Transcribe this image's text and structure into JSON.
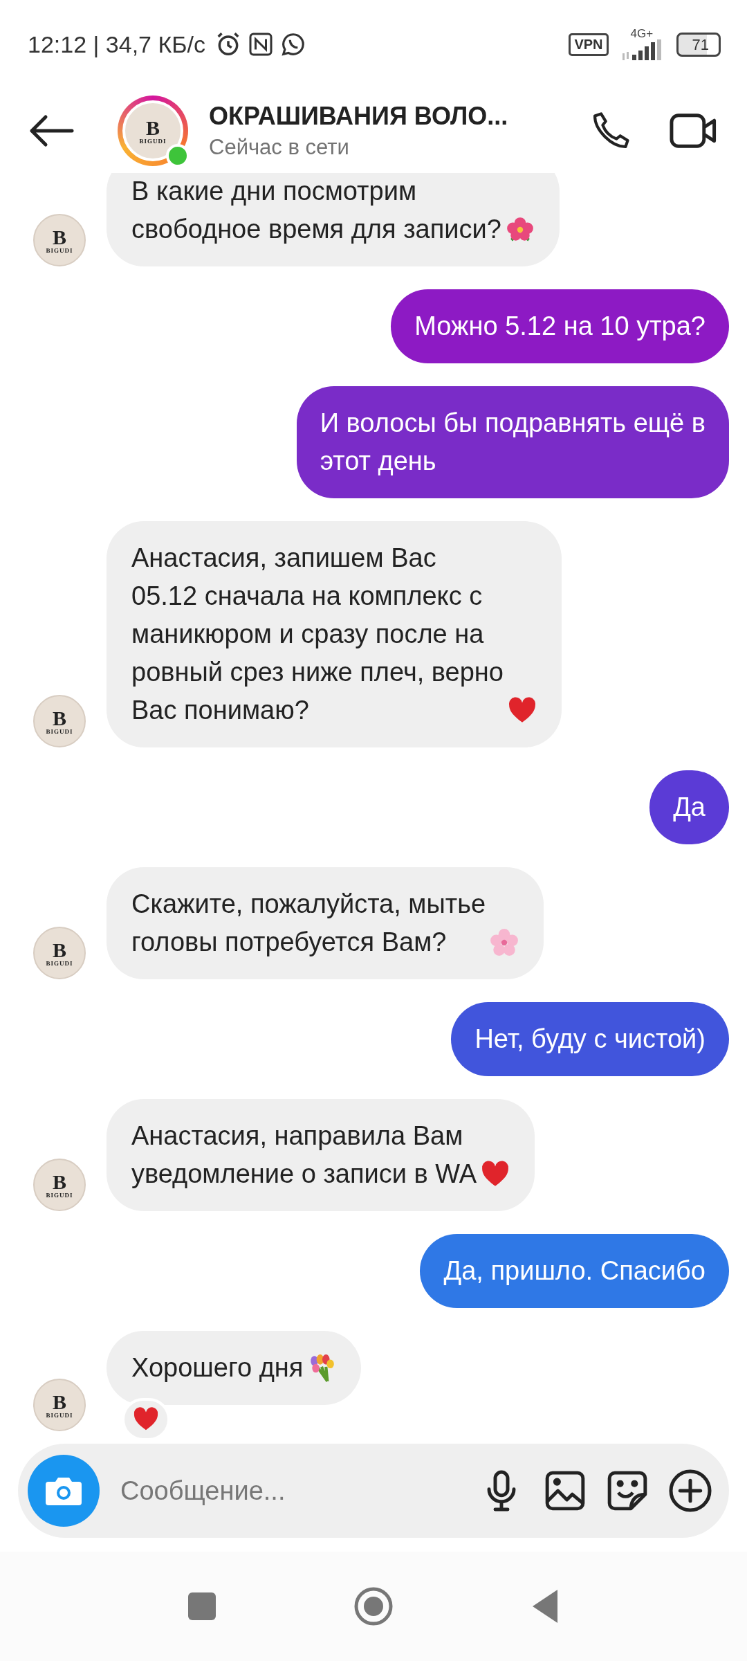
{
  "status_bar": {
    "time": "12:12 | 34,7 КБ/с",
    "vpn": "VPN",
    "network": "4G+",
    "battery": "71"
  },
  "header": {
    "title": "ОКРАШИВАНИЯ ВОЛО...",
    "subtitle": "Сейчас в сети",
    "online": true,
    "avatar": {
      "letter": "B",
      "caption": "BIGUDI"
    }
  },
  "messages": [
    {
      "kind": "incoming",
      "text": "В какие дни посмотрим\nсвободное время для записи?",
      "emoji": {
        "kind": "hibiscus"
      },
      "avatar": {
        "letter": "B",
        "caption": "BIGUDI"
      }
    },
    {
      "kind": "outgoing",
      "text": "Можно 5.12 на 10 утра?",
      "color": "#8d1ac4"
    },
    {
      "kind": "outgoing",
      "text": "И волосы бы подравнять ещё в\nэтот день",
      "color": "#7a2cc8"
    },
    {
      "kind": "incoming",
      "text": "Анастасия, запишем Вас\n05.12 сначала на комплекс с\nманикюром и сразу после на\nровный срез ниже плеч, верно\nВас понимаю?",
      "emoji": {
        "kind": "heart"
      },
      "avatar": {
        "letter": "B",
        "caption": "BIGUDI"
      }
    },
    {
      "kind": "outgoing",
      "text": "Да",
      "color": "#5b3bd6"
    },
    {
      "kind": "incoming",
      "text": "Скажите, пожалуйста, мытье\nголовы потребуется Вам?",
      "emoji": {
        "kind": "blossom"
      },
      "avatar": {
        "letter": "B",
        "caption": "BIGUDI"
      }
    },
    {
      "kind": "outgoing",
      "text": "Нет, буду с чистой)",
      "color": "#4155dc"
    },
    {
      "kind": "incoming",
      "text": "Анастасия, направила Вам\nуведомление о записи в WA",
      "emoji": {
        "kind": "heart"
      },
      "avatar": {
        "letter": "B",
        "caption": "BIGUDI"
      }
    },
    {
      "kind": "outgoing",
      "text": "Да, пришло. Спасибо",
      "color": "#2f78e6"
    },
    {
      "kind": "incoming",
      "text": "Хорошего дня",
      "emoji": {
        "kind": "bouquet"
      },
      "avatar": {
        "letter": "B",
        "caption": "BIGUDI"
      },
      "reaction": {
        "kind": "heart"
      }
    }
  ],
  "composer": {
    "placeholder": "Сообщение..."
  }
}
